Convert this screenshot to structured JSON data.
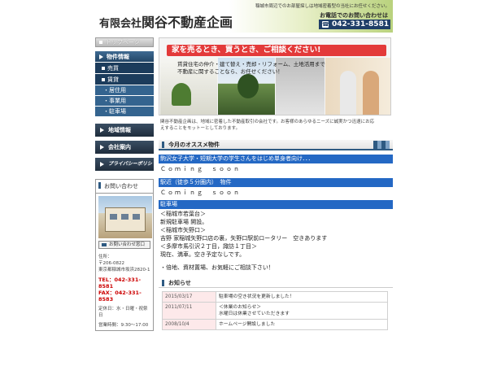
{
  "header": {
    "company_prefix": "有限会社",
    "company_name": "関谷不動産企画",
    "tagline": "稲城市周辺でのお部屋探しは地域密着型の当社にお任せください。",
    "contact_label": "お電話でのお問い合わせは",
    "phone": "042-331-8581"
  },
  "sidebar": {
    "top_page": "トップページ",
    "nav": [
      {
        "label": "物件情報",
        "type": "block"
      },
      {
        "label": "売買",
        "type": "item"
      },
      {
        "label": "賃貸",
        "type": "item"
      },
      {
        "label": "・居住用",
        "type": "sub"
      },
      {
        "label": "・事業用",
        "type": "sub"
      },
      {
        "label": "・駐車場",
        "type": "sub"
      }
    ],
    "dark_links": [
      "地域情報",
      "会社案内",
      "プライバシーポリシー"
    ],
    "contact": {
      "heading": "お問い合わせ",
      "mail_button": "お問い合わせ窓口",
      "address_label": "住所：",
      "zip": "〒206-0822",
      "address": "東京都稲城市坂浜2820-1",
      "tel": "TEL：042-331-8581",
      "fax": "FAX：042-331-8583",
      "holidays": "定休日：水・日曜・祝祭日",
      "hours": "営業時間：9:30～17:00"
    }
  },
  "hero": {
    "slogan": "家を売るとき、買うとき、ご相談ください!",
    "line1": "賃貸住宅の仲介・建て替え・売却・リフォーム、土地活用まで",
    "line2": "不動産に関することなら、お任せください！"
  },
  "intro": {
    "line1": "関谷不動産企画は、地域に密着した不動産取引の会社です。お客様のあらゆるニーズに誠実かつ迅速にお応",
    "line2": "えすることをモットーとしております。"
  },
  "recommend": {
    "title": "今月のオススメ物件",
    "band1": "駒沢女子大学・短期大学の学生さんをはじめ単身者向け．．．",
    "soon1": "Ｃｏｍｉｎｇ　ｓｏｏｎ",
    "band2": "駅近（徒歩５分圏内）　物件",
    "soon2": "Ｃｏｍｉｎｇ　ｓｏｏｎ",
    "band3": "駐車場",
    "lines": [
      "＜稲城市若葉台＞",
      "新規駐車場 開設。",
      "＜稲城市矢野口＞",
      "吉野 家稲城矢野口店の裏，矢野口駅前ロータリー　空きあります",
      "＜多摩市馬引沢２丁目，諏訪１丁目＞",
      "現在、満車。空き予定なしです。",
      "",
      "・倍地、資材置場、お気軽にご相談下さい！"
    ]
  },
  "news": {
    "title": "お知らせ",
    "rows": [
      {
        "date": "2015/03/17",
        "lines": [
          "駐車場の空き状況を更新しました！"
        ]
      },
      {
        "date": "2011/07/11",
        "lines": [
          "＜休業のお知らせ＞",
          "水曜日は休業させていただきます"
        ]
      },
      {
        "date": "2008/10/4",
        "lines": [
          "ホームページ開設しました"
        ]
      }
    ]
  }
}
